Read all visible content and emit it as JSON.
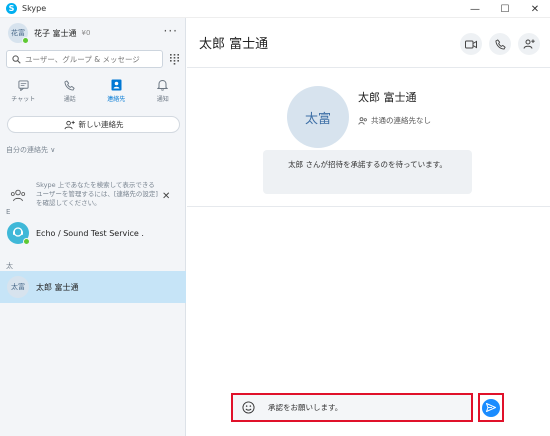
{
  "window": {
    "title": "Skype",
    "icon_glyph": "S",
    "controls": [
      "—",
      "☐",
      "✕"
    ]
  },
  "profile": {
    "initials": "花富",
    "name": "花子 富士通",
    "credit": "¥0",
    "presence_color": "#5fc933"
  },
  "search": {
    "placeholder": "ユーザー、グループ & メッセージ"
  },
  "tabs": [
    {
      "label": "チャット",
      "icon": "chat-icon"
    },
    {
      "label": "通話",
      "icon": "phone-icon"
    },
    {
      "label": "連絡先",
      "icon": "contacts-icon",
      "active": true
    },
    {
      "label": "通知",
      "icon": "bell-icon"
    }
  ],
  "new_contact": {
    "label": "新しい連絡先"
  },
  "sections": {
    "my_contacts": "自分の連絡先 ∨",
    "group_e": "E",
    "group_ta": "太"
  },
  "notice": {
    "text": "Skype 上であなたを検索して表示できるユーザーを管理するには、[連絡先の設定] を確認してください。"
  },
  "contacts": [
    {
      "name": "Echo / Sound Test Service .",
      "avatar": "echo"
    },
    {
      "name": "太郎 富士通",
      "initials": "太富",
      "selected": true
    }
  ],
  "main": {
    "title": "太郎 富士通",
    "contact_initials": "太富",
    "contact_name": "太郎 富士通",
    "mutual_contacts": "共通の連絡先なし",
    "invite_message": "太郎 さんが招待を承諾するのを待っています。"
  },
  "compose": {
    "value": "承認をお願いします。"
  },
  "colors": {
    "accent": "#0078d4",
    "send_button": "#1a8cff",
    "highlight_box": "#e0112a",
    "selected_row": "#c6e4f7"
  }
}
